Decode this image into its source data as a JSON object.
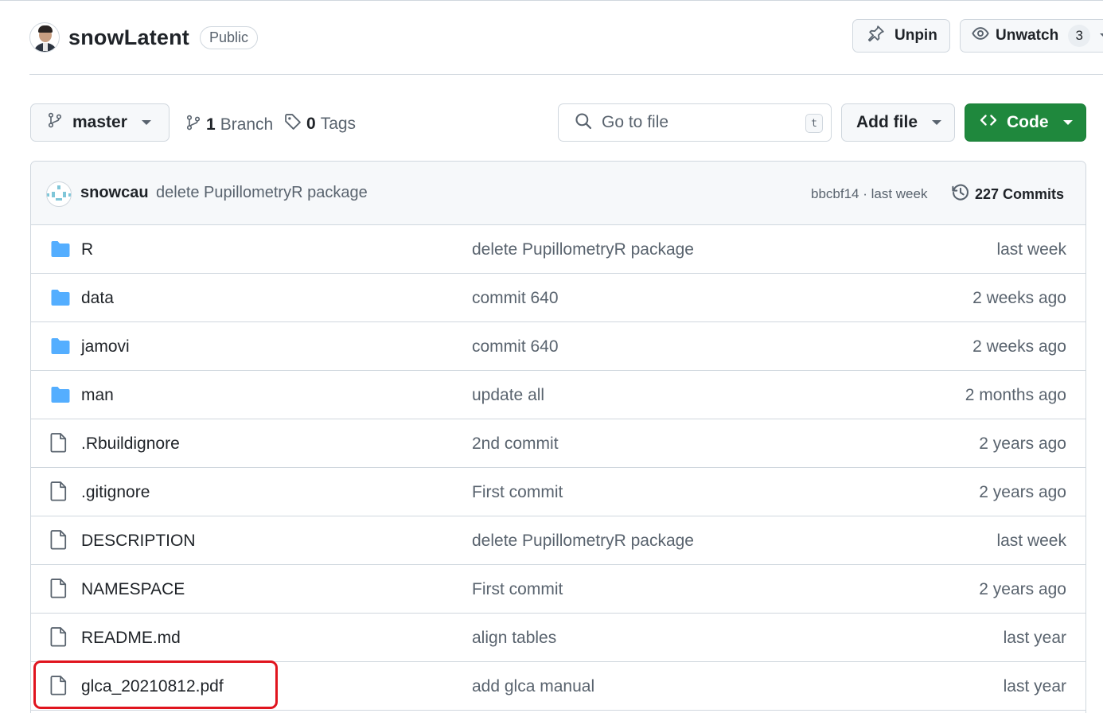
{
  "repo": {
    "name": "snowLatent",
    "visibility": "Public",
    "owner_avatar": "owner-avatar-photo"
  },
  "header_actions": {
    "unpin_label": "Unpin",
    "unpin_icon": "pin-icon",
    "unwatch_label": "Unwatch",
    "unwatch_icon": "eye-icon",
    "watch_count": "3"
  },
  "toolbar": {
    "branch_name": "master",
    "branch_count": "1",
    "branch_label": "Branch",
    "tag_count": "0",
    "tag_label": "Tags",
    "search_placeholder": "Go to file",
    "search_shortcut": "t",
    "add_file_label": "Add file",
    "code_label": "Code"
  },
  "latest_commit": {
    "author": "snowcau",
    "message": "delete PupillometryR package",
    "hash_time": "bbcbf14 · last week",
    "commits_label": "227 Commits"
  },
  "files": [
    {
      "type": "folder",
      "name": "R",
      "message": "delete PupillometryR package",
      "age": "last week"
    },
    {
      "type": "folder",
      "name": "data",
      "message": "commit 640",
      "age": "2 weeks ago"
    },
    {
      "type": "folder",
      "name": "jamovi",
      "message": "commit 640",
      "age": "2 weeks ago"
    },
    {
      "type": "folder",
      "name": "man",
      "message": "update all",
      "age": "2 months ago"
    },
    {
      "type": "file",
      "name": ".Rbuildignore",
      "message": "2nd commit",
      "age": "2 years ago"
    },
    {
      "type": "file",
      "name": ".gitignore",
      "message": "First commit",
      "age": "2 years ago"
    },
    {
      "type": "file",
      "name": "DESCRIPTION",
      "message": "delete PupillometryR package",
      "age": "last week"
    },
    {
      "type": "file",
      "name": "NAMESPACE",
      "message": "First commit",
      "age": "2 years ago"
    },
    {
      "type": "file",
      "name": "README.md",
      "message": "align tables",
      "age": "last year"
    },
    {
      "type": "file",
      "name": "glca_20210812.pdf",
      "message": "add glca manual",
      "age": "last year"
    }
  ],
  "colors": {
    "folder_icon": "#54aeff",
    "code_button": "#1f883d",
    "highlight": "#e0141e"
  },
  "highlighted_file": "glca_20210812.pdf"
}
